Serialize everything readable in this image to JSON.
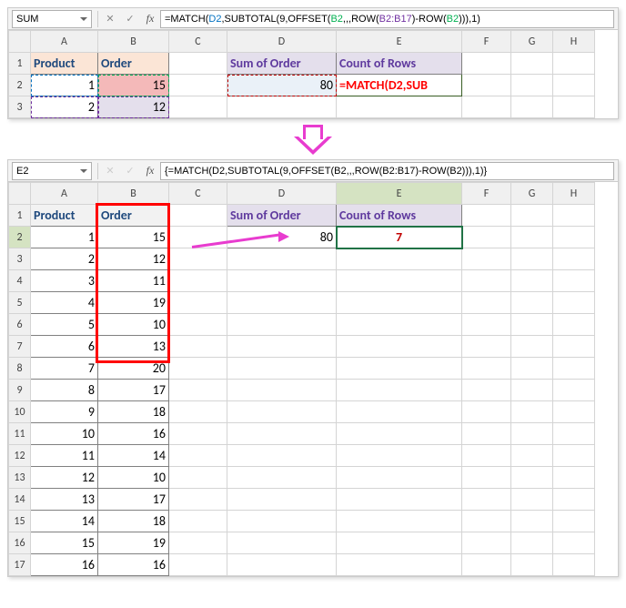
{
  "top": {
    "namebox": "SUM",
    "formula_parts": {
      "p1": "=MATCH(",
      "ref_d2": "D2",
      "p2": ",SUBTOTAL(9,OFFSET(",
      "ref_b2a": "B2",
      "p3": ",,,ROW(",
      "ref_range": "B2:B17",
      "p4": ")-ROW(",
      "ref_b2b": "B2",
      "p5": "))),1)"
    },
    "cols": [
      "A",
      "B",
      "C",
      "D",
      "E",
      "F",
      "G",
      "H"
    ],
    "rows": [
      "1",
      "2",
      "3"
    ],
    "a1": "Product",
    "b1": "Order",
    "d1": "Sum of Order",
    "e1": "Count of Rows",
    "a2": "1",
    "b2": "15",
    "d2": "80",
    "e2_display": "=MATCH(D2,SUB",
    "a3": "2",
    "b3": "12"
  },
  "bottom": {
    "namebox": "E2",
    "formula": "{=MATCH(D2,SUBTOTAL(9,OFFSET(B2,,,ROW(B2:B17)-ROW(B2))),1)}",
    "cols": [
      "A",
      "B",
      "C",
      "D",
      "E",
      "F",
      "G",
      "H"
    ],
    "headers": {
      "a1": "Product",
      "b1": "Order",
      "d1": "Sum of Order",
      "e1": "Count of Rows"
    },
    "d2": "80",
    "e2": "7",
    "data": [
      {
        "r": "1",
        "p": "1",
        "o": "15"
      },
      {
        "r": "2",
        "p": "2",
        "o": "12"
      },
      {
        "r": "3",
        "p": "3",
        "o": "11"
      },
      {
        "r": "4",
        "p": "4",
        "o": "19"
      },
      {
        "r": "5",
        "p": "5",
        "o": "10"
      },
      {
        "r": "6",
        "p": "6",
        "o": "13"
      },
      {
        "r": "7",
        "p": "7",
        "o": "20"
      },
      {
        "r": "8",
        "p": "8",
        "o": "17"
      },
      {
        "r": "9",
        "p": "9",
        "o": "18"
      },
      {
        "r": "10",
        "p": "10",
        "o": "16"
      },
      {
        "r": "11",
        "p": "11",
        "o": "14"
      },
      {
        "r": "12",
        "p": "12",
        "o": "10"
      },
      {
        "r": "13",
        "p": "13",
        "o": "17"
      },
      {
        "r": "14",
        "p": "14",
        "o": "18"
      },
      {
        "r": "15",
        "p": "15",
        "o": "19"
      },
      {
        "r": "16",
        "p": "16",
        "o": "16"
      }
    ]
  },
  "chart_data": {
    "type": "table",
    "title": "Excel MATCH running SUBTOTAL example",
    "headers": [
      "Product",
      "Order"
    ],
    "rows": [
      [
        1,
        15
      ],
      [
        2,
        12
      ],
      [
        3,
        11
      ],
      [
        4,
        19
      ],
      [
        5,
        10
      ],
      [
        6,
        13
      ],
      [
        7,
        20
      ],
      [
        8,
        17
      ],
      [
        9,
        18
      ],
      [
        10,
        16
      ],
      [
        11,
        14
      ],
      [
        12,
        10
      ],
      [
        13,
        17
      ],
      [
        14,
        18
      ],
      [
        15,
        19
      ],
      [
        16,
        16
      ]
    ],
    "summary": {
      "Sum of Order": 80,
      "Count of Rows": 7
    }
  }
}
